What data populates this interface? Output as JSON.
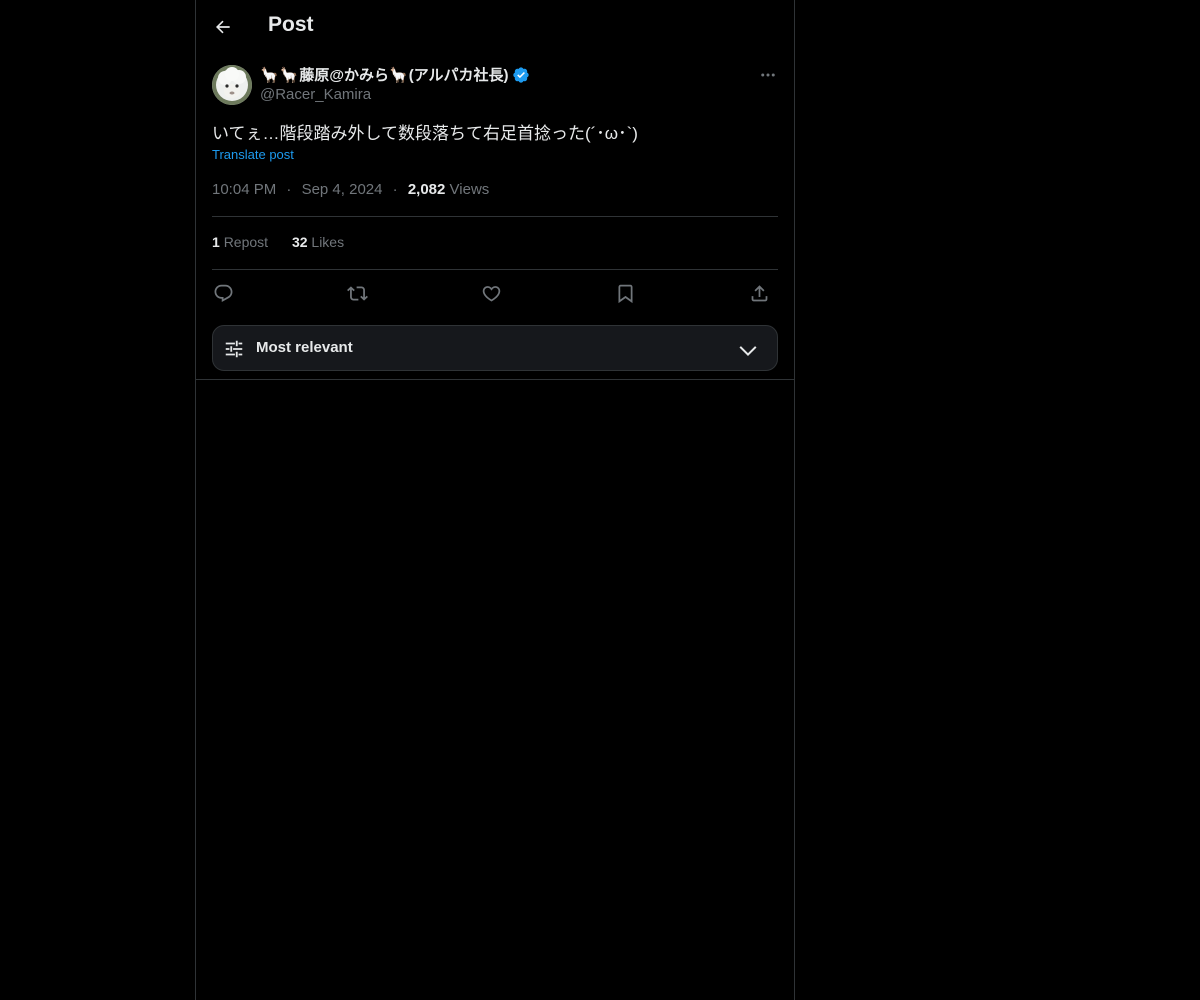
{
  "header": {
    "title": "Post"
  },
  "post": {
    "author": {
      "name": "藤原@かみら",
      "name_suffix": "(アルパカ社長)",
      "llama_emoji": "🦙",
      "handle": "@Racer_Kamira",
      "verified": true
    },
    "text": "いてぇ…階段踏み外して数段落ちて右足首捻った(´･ω･`)",
    "translate_label": "Translate post",
    "time": "10:04 PM",
    "date": "Sep 4, 2024",
    "views_count": "2,082",
    "views_label": "Views",
    "separator": "·"
  },
  "stats": {
    "reposts_count": "1",
    "reposts_label": "Repost",
    "likes_count": "32",
    "likes_label": "Likes"
  },
  "sort": {
    "label": "Most relevant"
  },
  "colors": {
    "background": "#000000",
    "border": "#2f3336",
    "text_primary": "#e7e9ea",
    "text_secondary": "#71767b",
    "accent": "#1d9bf0"
  },
  "icons": {
    "back": "arrow-left-icon",
    "verified": "verified-badge-icon",
    "more": "more-horizontal-icon",
    "reply": "reply-icon",
    "repost": "repost-icon",
    "like": "heart-icon",
    "bookmark": "bookmark-icon",
    "share": "share-icon",
    "sort": "sliders-icon",
    "chevron": "chevron-down-icon"
  }
}
